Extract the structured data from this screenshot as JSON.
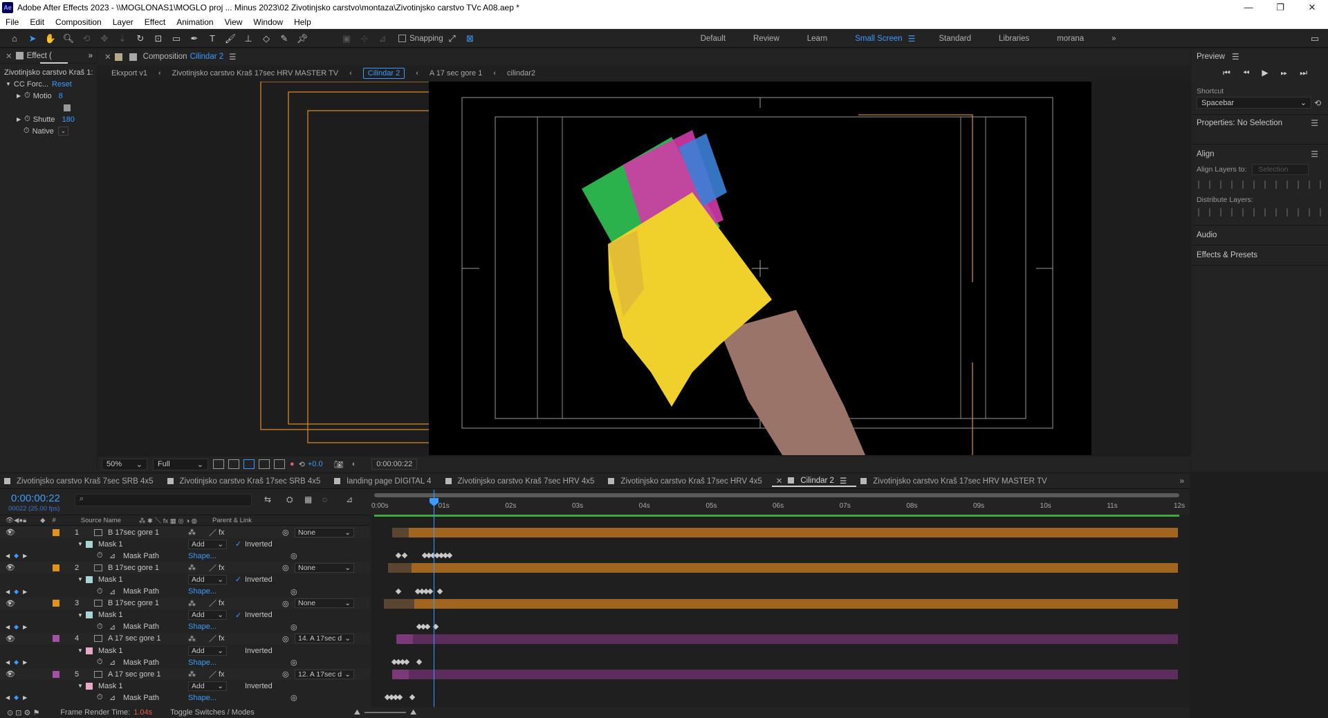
{
  "window": {
    "title": "Adobe After Effects 2023 - \\\\MOGLONAS1\\MOGLO proj ... Minus 2023\\02 Zivotinjsko carstvo\\montaza\\Zivotinjsko carstvo TVc A08.aep *",
    "app_badge": "Ae",
    "minimize": "—",
    "restore": "❐",
    "close": "✕"
  },
  "menu": [
    "File",
    "Edit",
    "Composition",
    "Layer",
    "Effect",
    "Animation",
    "View",
    "Window",
    "Help"
  ],
  "toolbar": {
    "snapping_label": "Snapping",
    "workspaces": [
      "Default",
      "Review",
      "Learn",
      "Small Screen",
      "Standard",
      "Libraries",
      "morana"
    ],
    "active_workspace": "Small Screen",
    "more": "»"
  },
  "effect_controls": {
    "tab_label": "Effect (",
    "source": "Zivotinjsko carstvo Kraš 1:",
    "effect_name": "CC Forc...",
    "reset": "Reset",
    "rows": [
      {
        "label": "Motio",
        "value": "8"
      },
      {
        "label": "Shutte",
        "value": "180"
      },
      {
        "label": "Native",
        "value": ""
      }
    ]
  },
  "composition": {
    "tab_prefix": "Composition",
    "tab_name": "Cilindar 2",
    "breadcrumbs": [
      "Ekxport v1",
      "Zivotinjsko carstvo Kraš 17sec HRV MASTER TV",
      "Cilindar 2",
      "A 17 sec gore 1",
      "cilindar2"
    ],
    "active_breadcrumb": "Cilindar 2",
    "zoom": "50%",
    "resolution": "Full",
    "exposure": "+0.0",
    "timecode": "0:00:00:22"
  },
  "right_panel": {
    "preview": "Preview",
    "shortcut_label": "Shortcut",
    "shortcut_value": "Spacebar",
    "properties": "Properties: No Selection",
    "align": "Align",
    "align_layers_to": "Align Layers to:",
    "align_target": "Selection",
    "distribute_layers": "Distribute Layers:",
    "audio": "Audio",
    "effects_presets": "Effects & Presets"
  },
  "timeline": {
    "tabs": [
      "Zivotinjsko carstvo Kraš 7sec SRB 4x5",
      "Zivotinjsko carstvo Kraš 17sec SRB 4x5",
      "landing page DIGITAL 4",
      "Zivotinjsko carstvo Kraš 7sec HRV 4x5",
      "Zivotinjsko carstvo Kraš 17sec HRV 4x5",
      "Cilindar 2",
      "Zivotinjsko carstvo Kraš 17sec HRV MASTER TV"
    ],
    "active_tab": "Cilindar 2",
    "timecode": "0:00:00:22",
    "frame_info": "00022 (25.00 fps)",
    "col_source": "Source Name",
    "col_parent": "Parent & Link",
    "ruler": [
      "0:00s",
      "01s",
      "02s",
      "03s",
      "04s",
      "05s",
      "06s",
      "07s",
      "08s",
      "09s",
      "10s",
      "11s",
      "12s"
    ],
    "layers": [
      {
        "num": "1",
        "name": "B 17sec gore 1",
        "parent": "None",
        "inverted_checked": true,
        "mask_label": "Mask 1",
        "mode": "Add",
        "inverted": "Inverted",
        "mask_path": "Mask Path",
        "shape": "Shape...",
        "color": "#e2921e",
        "mask_color": "#a8d4d4"
      },
      {
        "num": "2",
        "name": "B 17sec gore 1",
        "parent": "None",
        "inverted_checked": true,
        "mask_label": "Mask 1",
        "mode": "Add",
        "inverted": "Inverted",
        "mask_path": "Mask Path",
        "shape": "Shape...",
        "color": "#e2921e",
        "mask_color": "#a8d4d4"
      },
      {
        "num": "3",
        "name": "B 17sec gore 1",
        "parent": "None",
        "inverted_checked": true,
        "mask_label": "Mask 1",
        "mode": "Add",
        "inverted": "Inverted",
        "mask_path": "Mask Path",
        "shape": "Shape...",
        "color": "#e2921e",
        "mask_color": "#a8d4d4"
      },
      {
        "num": "4",
        "name": "A 17 sec gore 1",
        "parent": "14. A 17sec d",
        "inverted_checked": false,
        "mask_label": "Mask 1",
        "mode": "Add",
        "inverted": "Inverted",
        "mask_path": "Mask Path",
        "shape": "Shape...",
        "color": "#a552a5",
        "mask_color": "#e8a8c8"
      },
      {
        "num": "5",
        "name": "A 17 sec gore 1",
        "parent": "12. A 17sec d",
        "inverted_checked": false,
        "mask_label": "Mask 1",
        "mode": "Add",
        "inverted": "Inverted",
        "mask_path": "Mask Path",
        "shape": "Shape...",
        "color": "#a552a5",
        "mask_color": "#e8a8c8"
      }
    ],
    "status": {
      "frame_render_label": "Frame Render Time:",
      "frame_render_value": "1.04s",
      "toggle": "Toggle Switches / Modes"
    }
  }
}
